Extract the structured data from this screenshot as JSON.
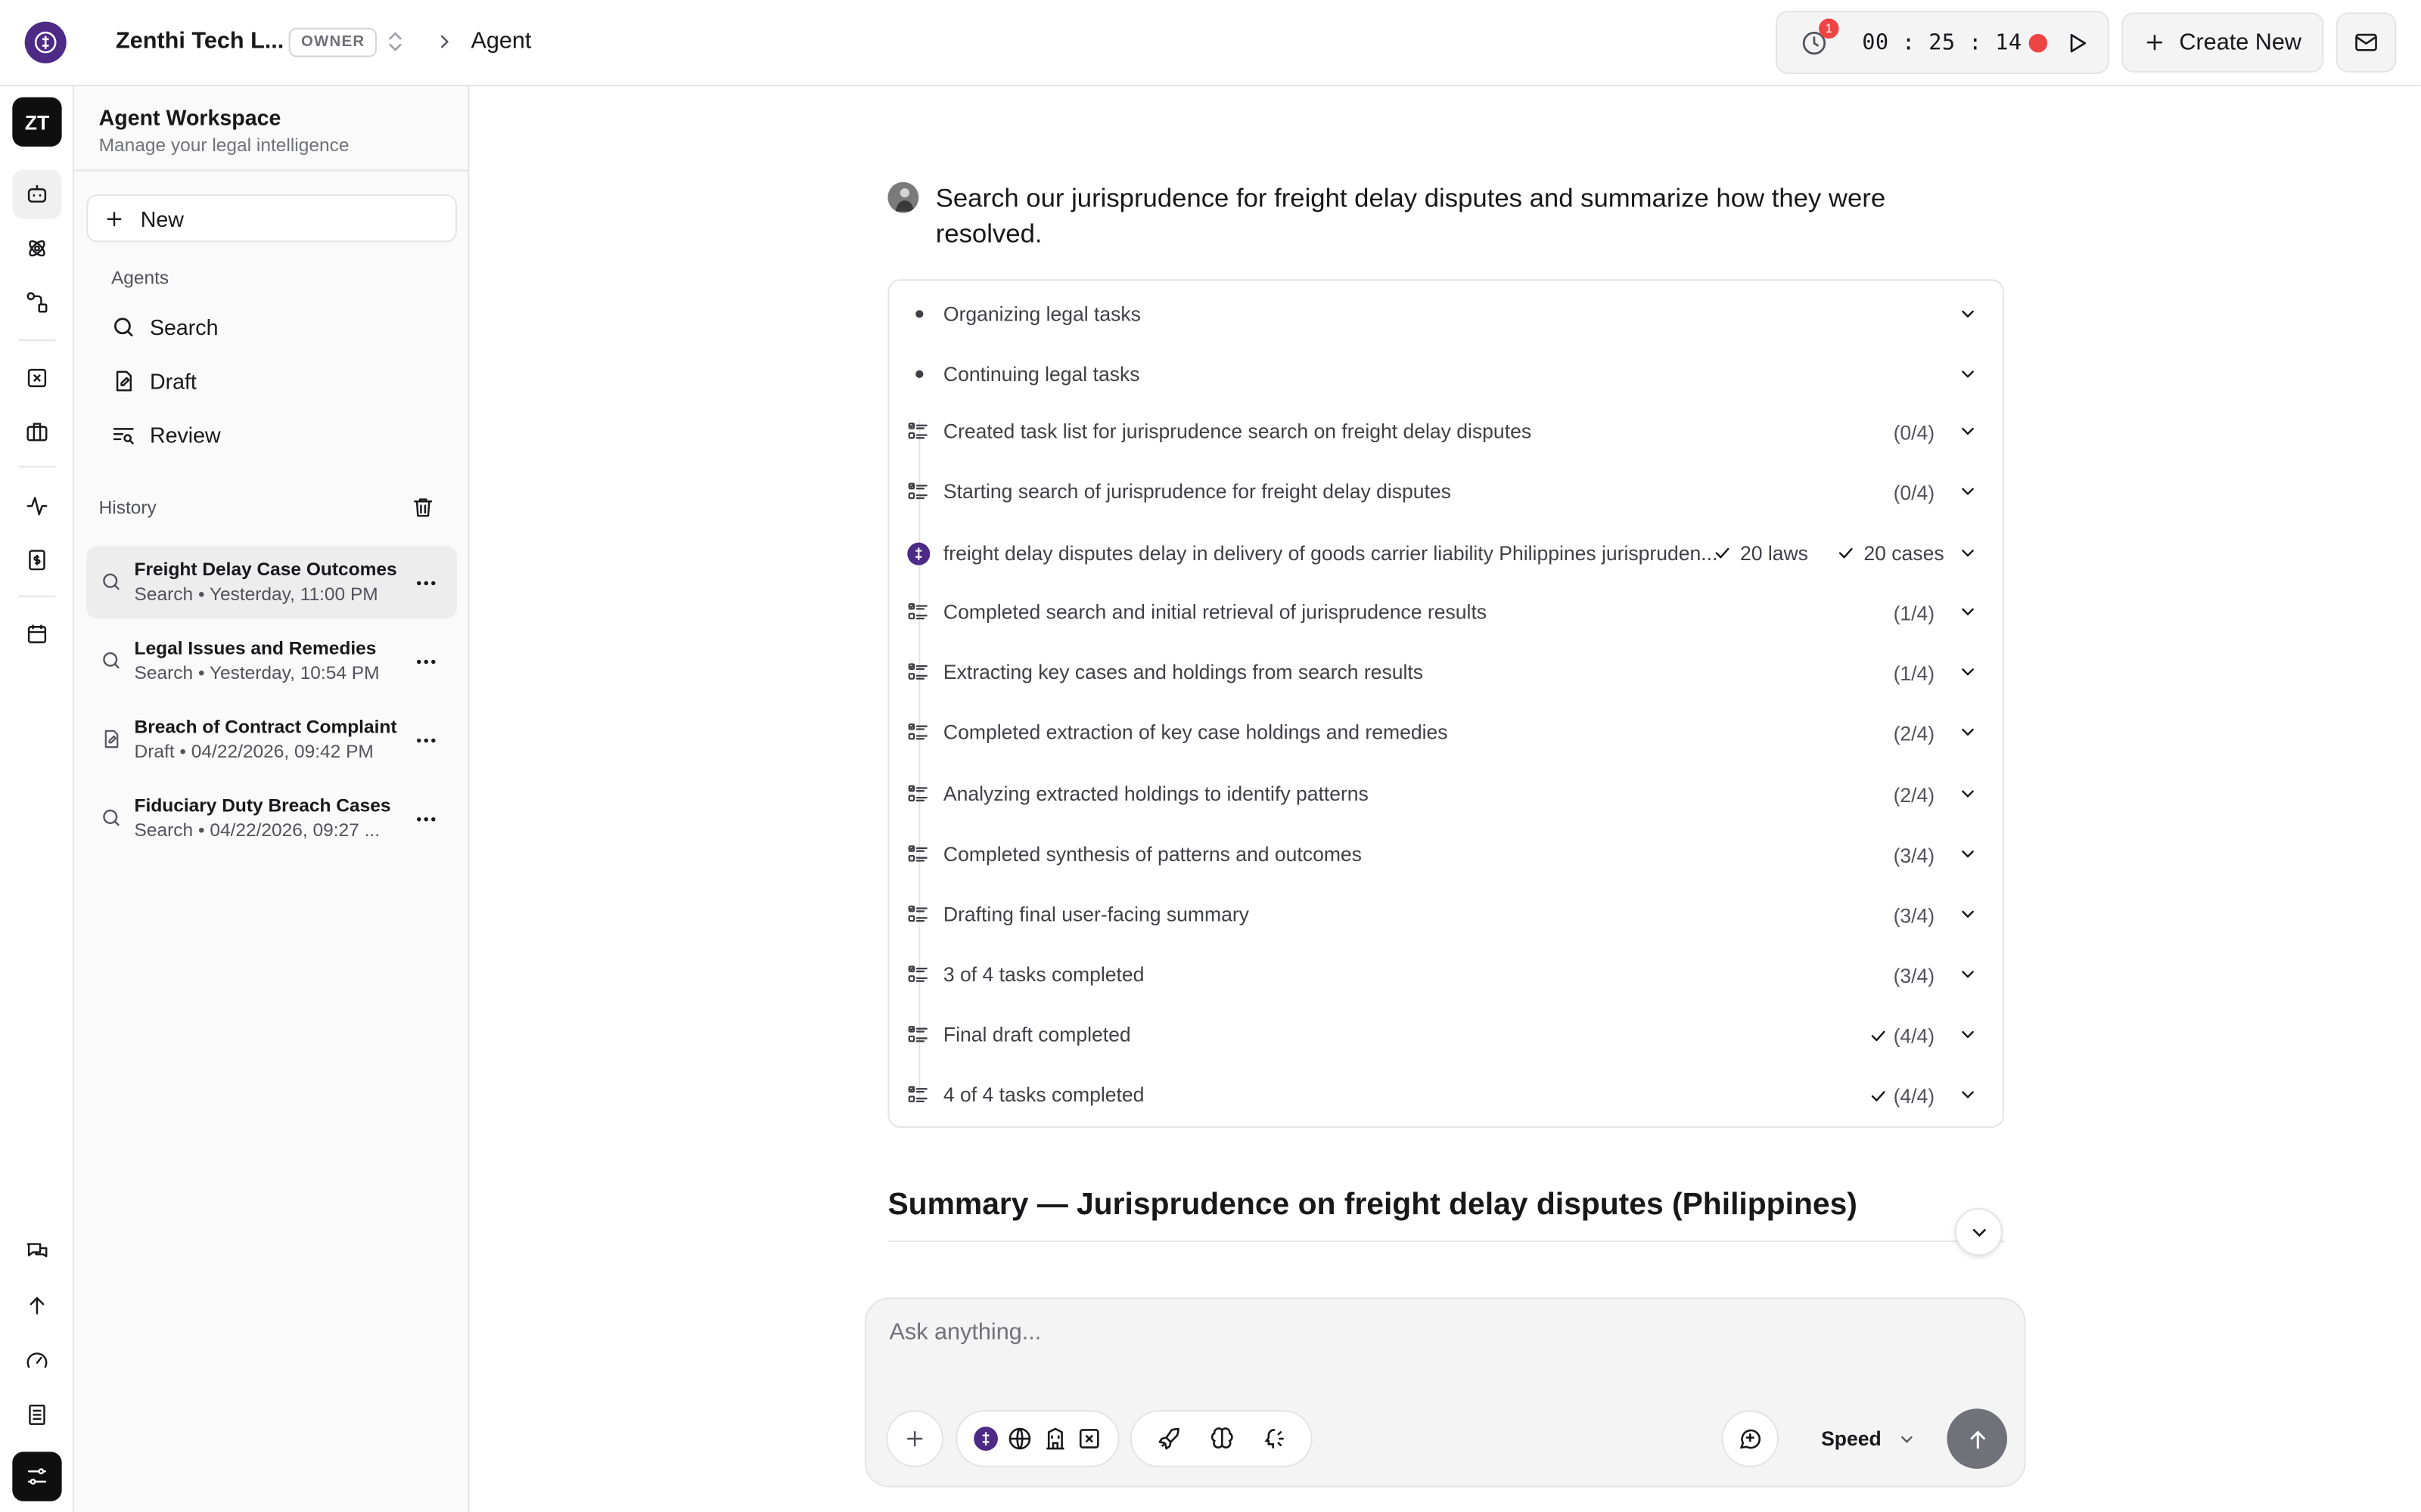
{
  "header": {
    "org_name": "Zenthi Tech L...",
    "role_badge": "OWNER",
    "breadcrumb_current": "Agent",
    "notification_count": "1",
    "timer": "00 : 25 : 14",
    "create_new_label": "Create New"
  },
  "rail": {
    "avatar_initials": "ZT"
  },
  "sidebar": {
    "workspace_title": "Agent Workspace",
    "workspace_subtitle": "Manage your legal intelligence",
    "new_label": "New",
    "agents_section": "Agents",
    "agents": [
      {
        "label": "Search",
        "icon": "search-icon"
      },
      {
        "label": "Draft",
        "icon": "draft-icon"
      },
      {
        "label": "Review",
        "icon": "review-icon"
      }
    ],
    "history_section": "History",
    "history": [
      {
        "title": "Freight Delay Case Outcomes",
        "subtitle": "Search • Yesterday, 11:00 PM",
        "icon": "search-icon",
        "active": true
      },
      {
        "title": "Legal Issues and Remedies",
        "subtitle": "Search • Yesterday, 10:54 PM",
        "icon": "search-icon",
        "active": false
      },
      {
        "title": "Breach of Contract Complaint",
        "subtitle": "Draft • 04/22/2026, 09:42 PM",
        "icon": "document-icon",
        "active": false
      },
      {
        "title": "Fiduciary Duty Breach Cases",
        "subtitle": "Search • 04/22/2026, 09:27 ...",
        "icon": "search-icon",
        "active": false
      }
    ]
  },
  "conversation": {
    "query": "Search our jurisprudence for freight delay disputes and summarize how they were resolved.",
    "steps": [
      {
        "text": "Organizing legal tasks",
        "kind": "bullet",
        "count": ""
      },
      {
        "text": "Continuing legal tasks",
        "kind": "bullet",
        "count": ""
      },
      {
        "text": "Created task list for jurisprudence search on freight delay disputes",
        "kind": "tasks",
        "count": "(0/4)"
      },
      {
        "text": "Starting search of jurisprudence for freight delay disputes",
        "kind": "tasks",
        "count": "(0/4)"
      },
      {
        "text": "freight delay disputes delay in delivery of goods carrier liability Philippines jurispruden...",
        "kind": "search",
        "count": "",
        "laws": "20 laws",
        "cases": "20 cases"
      },
      {
        "text": "Completed search and initial retrieval of jurisprudence results",
        "kind": "tasks",
        "count": "(1/4)"
      },
      {
        "text": "Extracting key cases and holdings from search results",
        "kind": "tasks",
        "count": "(1/4)"
      },
      {
        "text": "Completed extraction of key case holdings and remedies",
        "kind": "tasks",
        "count": "(2/4)"
      },
      {
        "text": "Analyzing extracted holdings to identify patterns",
        "kind": "tasks",
        "count": "(2/4)"
      },
      {
        "text": "Completed synthesis of patterns and outcomes",
        "kind": "tasks",
        "count": "(3/4)"
      },
      {
        "text": "Drafting final user-facing summary",
        "kind": "tasks",
        "count": "(3/4)"
      },
      {
        "text": "3 of 4 tasks completed",
        "kind": "tasks",
        "count": "(3/4)"
      },
      {
        "text": "Final draft completed",
        "kind": "tasks",
        "count": "(4/4)",
        "done": true
      },
      {
        "text": "4 of 4 tasks completed",
        "kind": "tasks",
        "count": "(4/4)",
        "done": true
      }
    ],
    "summary_title": "Summary — Jurisprudence on freight delay disputes (Philippines)"
  },
  "composer": {
    "placeholder": "Ask anything...",
    "speed_label": "Speed"
  },
  "colors": {
    "brand": "#4c2a85",
    "record": "#ef4444",
    "send": "#71717a"
  }
}
